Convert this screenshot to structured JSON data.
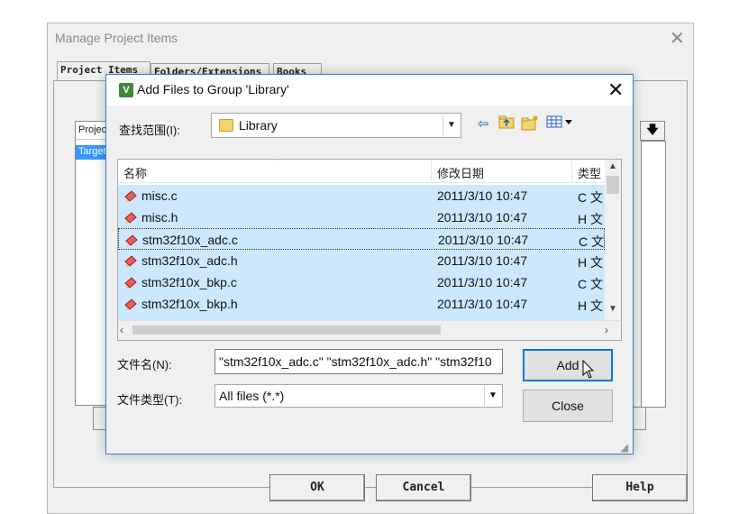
{
  "manage_window": {
    "title": "Manage Project Items",
    "tabs": [
      "Project Items",
      "Folders/Extensions",
      "Books"
    ],
    "project_header": "Project",
    "project_selected": "Target",
    "buttons": {
      "ok": "OK",
      "cancel": "Cancel",
      "help": "Help"
    }
  },
  "dialog": {
    "title": "Add Files to Group 'Library'",
    "look_in_label": "查找范围(I):",
    "look_in_value": "Library",
    "columns": {
      "name": "名称",
      "modified": "修改日期",
      "type": "类型"
    },
    "files": [
      {
        "name": "misc.c",
        "modified": "2011/3/10 10:47",
        "type": "C 文"
      },
      {
        "name": "misc.h",
        "modified": "2011/3/10 10:47",
        "type": "H 文"
      },
      {
        "name": "stm32f10x_adc.c",
        "modified": "2011/3/10 10:47",
        "type": "C 文"
      },
      {
        "name": "stm32f10x_adc.h",
        "modified": "2011/3/10 10:47",
        "type": "H 文"
      },
      {
        "name": "stm32f10x_bkp.c",
        "modified": "2011/3/10 10:47",
        "type": "C 文"
      },
      {
        "name": "stm32f10x_bkp.h",
        "modified": "2011/3/10 10:47",
        "type": "H 文"
      }
    ],
    "filename_label": "文件名(N):",
    "filename_value": "\"stm32f10x_adc.c\" \"stm32f10x_adc.h\" \"stm32f10",
    "filetype_label": "文件类型(T):",
    "filetype_value": "All files (*.*)",
    "buttons": {
      "add": "Add",
      "close": "Close"
    }
  },
  "colors": {
    "selection": "#cce8ff",
    "accent": "#0078d7",
    "highlight": "#3399ff"
  }
}
